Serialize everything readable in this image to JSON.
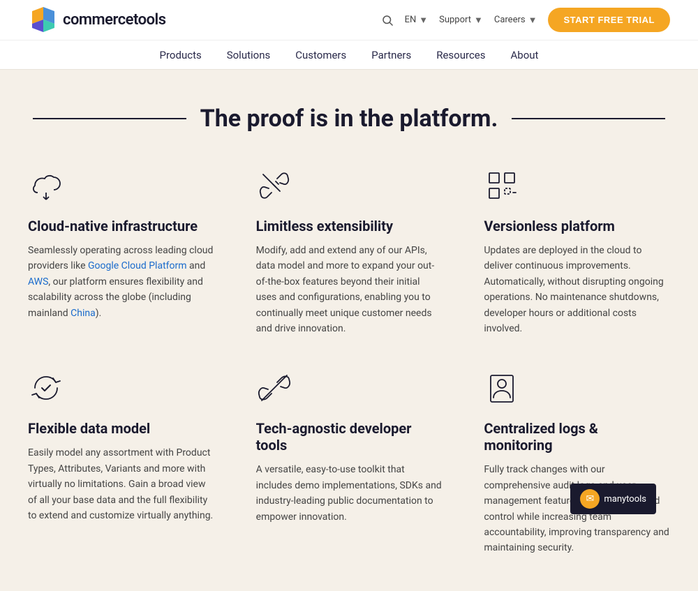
{
  "header": {
    "logo_text": "commercetools",
    "util": {
      "search_label": "search",
      "lang_label": "EN",
      "support_label": "Support",
      "careers_label": "Careers"
    },
    "cta_label": "START FREE TRIAL",
    "nav": [
      {
        "label": "Products",
        "id": "products"
      },
      {
        "label": "Solutions",
        "id": "solutions"
      },
      {
        "label": "Customers",
        "id": "customers"
      },
      {
        "label": "Partners",
        "id": "partners"
      },
      {
        "label": "Resources",
        "id": "resources"
      },
      {
        "label": "About",
        "id": "about"
      }
    ]
  },
  "main": {
    "section_title": "The proof is in the platform.",
    "features": [
      {
        "id": "cloud-native",
        "title": "Cloud-native infrastructure",
        "description": "Seamlessly operating across leading cloud providers like {Google Cloud Platform} and {AWS}, our platform ensures flexibility and scalability across the globe (including mainland {China}).",
        "desc_plain": "Seamlessly operating across leading cloud providers like ",
        "links": [
          {
            "text": "Google Cloud Platform",
            "href": "#"
          },
          {
            "text": "AWS",
            "href": "#"
          },
          {
            "text": "China",
            "href": "#"
          }
        ],
        "desc_after": ", our platform ensures flexibility and scalability across the globe (including mainland ",
        "desc_end": ").",
        "icon": "cloud"
      },
      {
        "id": "limitless",
        "title": "Limitless extensibility",
        "description": "Modify, add and extend any of our APIs, data model and more to expand your out-of-the-box features beyond their initial uses and configurations, enabling you to continually meet unique customer needs and drive innovation.",
        "icon": "plug"
      },
      {
        "id": "versionless",
        "title": "Versionless platform",
        "description": "Updates are deployed in the cloud to deliver continuous improvements. Automatically, without disrupting ongoing operations. No maintenance shutdowns, developer hours or additional costs involved.",
        "icon": "grid"
      },
      {
        "id": "flexible-data",
        "title": "Flexible data model",
        "description": "Easily model any assortment with Product Types, Attributes, Variants and more with virtually no limitations. Gain a broad view of all your base data and the full flexibility to extend and customize virtually anything.",
        "icon": "refresh-check"
      },
      {
        "id": "tech-agnostic",
        "title": "Tech-agnostic developer tools",
        "description": "A versatile, easy-to-use toolkit that includes demo implementations, SDKs and industry-leading public documentation to empower innovation.",
        "icon": "unlink"
      },
      {
        "id": "centralized-logs",
        "title": "Centralized logs & monitoring",
        "description": "Fully track changes with our comprehensive audit logs and user management features. Gain insights and control while increasing team accountability, improving transparency and maintaining security.",
        "icon": "monitor"
      }
    ]
  },
  "watermark": {
    "label": "manytools"
  }
}
